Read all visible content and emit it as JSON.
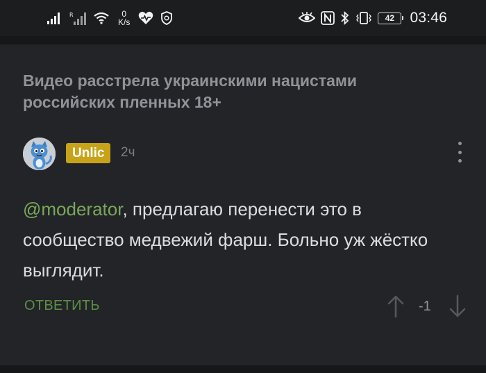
{
  "status_bar": {
    "net_speed_value": "0",
    "net_speed_unit": "K/s",
    "battery_level": "42",
    "time": "03:46",
    "icons_left": [
      "signal-icon",
      "signal-roaming-icon",
      "wifi-icon",
      "health-heart-icon",
      "shield-icon"
    ],
    "icons_right": [
      "eye-icon",
      "nfc-icon",
      "bluetooth-icon",
      "vibrate-icon",
      "battery-icon"
    ]
  },
  "post": {
    "title": "Видео расстрела украинскими нацистами российских пленных 18+"
  },
  "comment": {
    "username": "Unlic",
    "time_ago": "2ч",
    "mention": "@moderator",
    "text": ", предлагаю перенести это в сообщество медвежий фарш. Больно уж жёстко выглядит.",
    "reply_label": "ОТВЕТИТЬ",
    "rating": "-1"
  },
  "colors": {
    "background": "#222427",
    "username_badge": "#c8a319",
    "mention": "#7aa85a",
    "reply": "#5d8f45",
    "muted_text": "#8f9296"
  }
}
